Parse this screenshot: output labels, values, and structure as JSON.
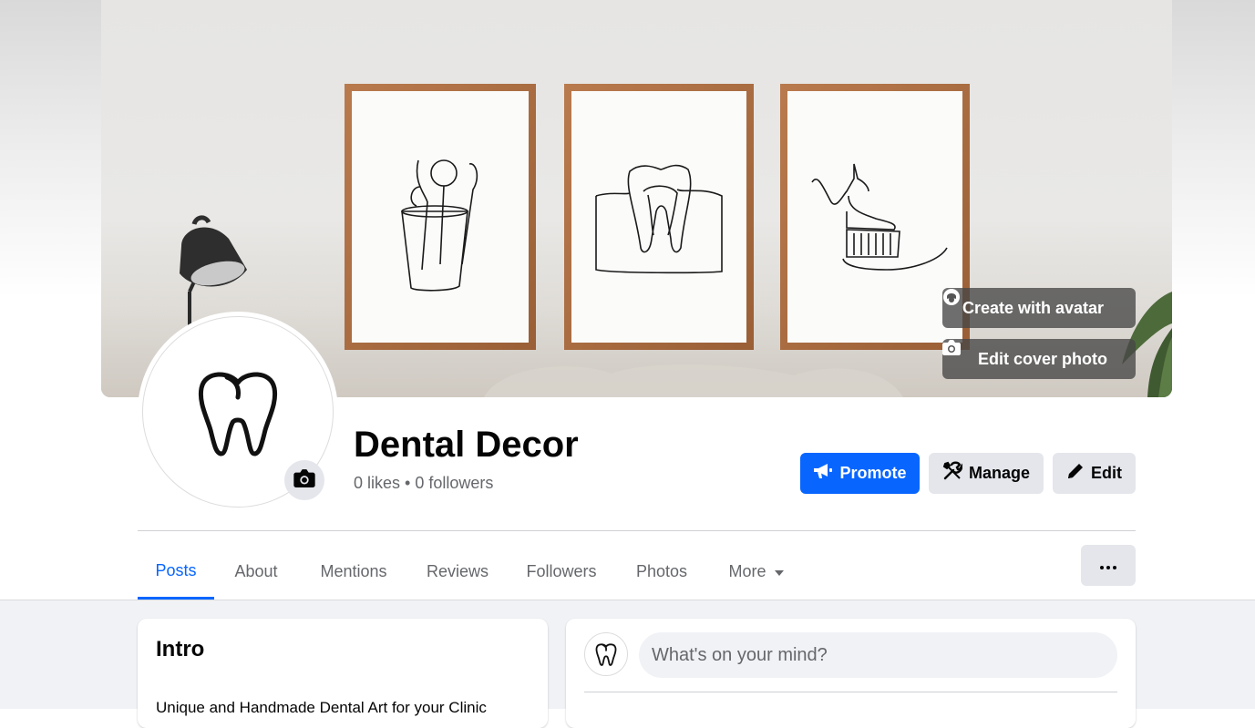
{
  "cover": {
    "create_avatar_label": "Create with avatar",
    "edit_cover_label": "Edit cover photo"
  },
  "profile": {
    "name": "Dental Decor",
    "likes": "0 likes",
    "separator": "•",
    "followers": "0 followers"
  },
  "actions": {
    "promote_label": "Promote",
    "manage_label": "Manage",
    "edit_label": "Edit"
  },
  "tabs": [
    {
      "label": "Posts",
      "active": true
    },
    {
      "label": "About",
      "active": false
    },
    {
      "label": "Mentions",
      "active": false
    },
    {
      "label": "Reviews",
      "active": false
    },
    {
      "label": "Followers",
      "active": false
    },
    {
      "label": "Photos",
      "active": false
    },
    {
      "label": "More",
      "active": false
    }
  ],
  "intro": {
    "title": "Intro",
    "bio": "Unique and Handmade Dental Art for your Clinic"
  },
  "composer": {
    "placeholder": "What's on your mind?"
  },
  "colors": {
    "accent": "#0866ff",
    "secondary_button": "#e4e6eb",
    "feed_background": "#f0f2f5",
    "muted_text": "#65676b"
  },
  "icons": {
    "promote": "megaphone-icon",
    "manage": "tools-icon",
    "edit": "pencil-icon",
    "avatar_camera": "camera-icon",
    "more_caret": "caret-down-icon",
    "more_options": "ellipsis-icon"
  }
}
